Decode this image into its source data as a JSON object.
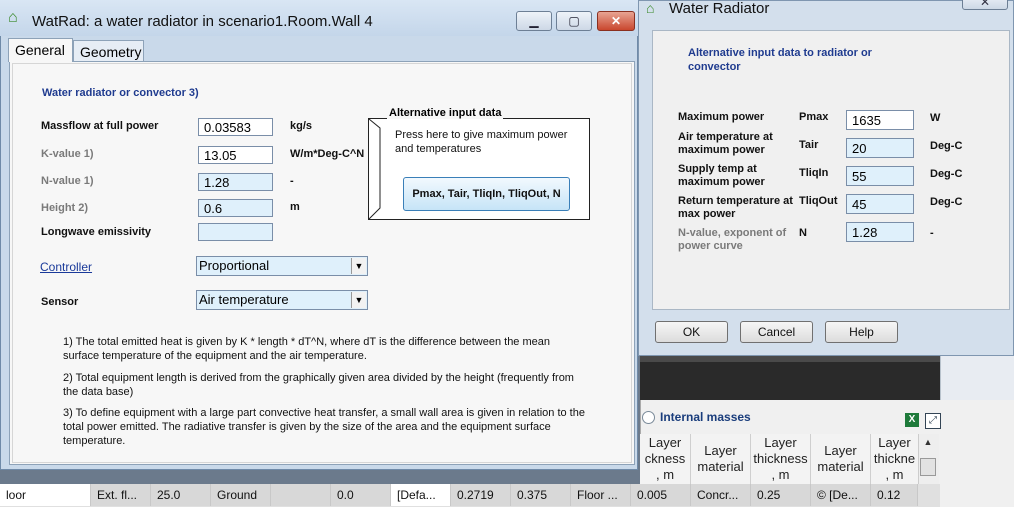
{
  "watrad": {
    "title": "WatRad: a water radiator in scenario1.Room.Wall 4",
    "controls": {
      "minimize": "▁",
      "maximize": "▢",
      "close": "✕"
    },
    "tabs": [
      "General",
      "Geometry"
    ],
    "section_heading": "Water radiator or convector 3)",
    "fields": {
      "massflow": {
        "label": "Massflow at full power",
        "value": "0.03583",
        "unit": "kg/s"
      },
      "kvalue": {
        "label": "K-value 1)",
        "value": "13.05",
        "unit": "W/m*Deg-C^N"
      },
      "nvalue": {
        "label": "N-value 1)",
        "value": "1.28",
        "unit": "-"
      },
      "height": {
        "label": "Height 2)",
        "value": "0.6",
        "unit": "m"
      },
      "emissivity": {
        "label": "Longwave emissivity",
        "value": ""
      }
    },
    "controller": {
      "label": "Controller",
      "value": "Proportional"
    },
    "sensor": {
      "label": "Sensor",
      "value": "Air temperature"
    },
    "alt": {
      "legend": "Alternative input data",
      "desc": "Press here to give maximum power and temperatures",
      "button": "Pmax, Tair, TliqIn, TliqOut, N"
    },
    "notes": [
      "1) The total emitted heat is given by K * length * dT^N, where dT is the difference between the mean surface temperature of the equipment and the air temperature.",
      "2) Total equipment length is derived from the graphically given area divided by the height (frequently from the data base)",
      "3) To define equipment with a large part convective heat transfer, a small wall area is given in relation to the total power emitted. The radiative transfer is given by the size of the area and the equipment surface temperature."
    ]
  },
  "dialog": {
    "title": "Water Radiator",
    "close": "✕",
    "heading": "Alternative input data to radiator or convector",
    "rows": [
      {
        "label": "Maximum power",
        "symbol": "Pmax",
        "value": "1635",
        "unit": "W"
      },
      {
        "label": "Air temperature at maximum power",
        "symbol": "Tair",
        "value": "20",
        "unit": "Deg-C"
      },
      {
        "label": "Supply temp at maximum power",
        "symbol": "TliqIn",
        "value": "55",
        "unit": "Deg-C"
      },
      {
        "label": "Return temperature at max power",
        "symbol": "TliqOut",
        "value": "45",
        "unit": "Deg-C"
      },
      {
        "label": "N-value, exponent of power curve",
        "symbol": "N",
        "value": "1.28",
        "unit": "-"
      }
    ],
    "buttons": {
      "ok": "OK",
      "cancel": "Cancel",
      "help": "Help"
    }
  },
  "background": {
    "internal_masses": "Internal masses",
    "excel_icon": "X",
    "expand_icon": "⤢",
    "headers": [
      "Layer thickness, m",
      "Layer material",
      "Layer thickness, m",
      "Layer material",
      "Layer thickness, m"
    ],
    "header_display": [
      "Layer\nckness\n, m",
      "Layer\nmaterial",
      "Layer\nthickness\n, m",
      "Layer\nmaterial",
      "Layer\nthickne\n, m"
    ],
    "row": [
      "loor",
      "Ext. fl...",
      "25.0",
      "Ground",
      "",
      "0.0",
      "[Defa...",
      "0.2719",
      "0.375",
      "Floor ...",
      "0.005",
      "Concr...",
      "0.25",
      "© [De...",
      "0.12"
    ]
  }
}
